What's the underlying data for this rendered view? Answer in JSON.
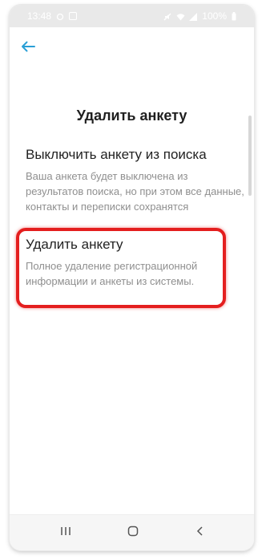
{
  "statusbar": {
    "time": "13:48",
    "battery": "100%"
  },
  "header": {
    "title": "Удалить анкету"
  },
  "options": [
    {
      "title": "Выключить анкету из поиска",
      "description": "Ваша анкета будет выключена из результатов поиска, но при этом все данные, контакты и переписки сохранятся"
    },
    {
      "title": "Удалить анкету",
      "description": "Полное удаление регистрационной информации и анкеты из системы."
    }
  ],
  "colors": {
    "accent": "#2a9fd6",
    "highlight": "#e41e1e",
    "text": "#222222",
    "subtext": "#8f8f8f"
  },
  "icons": {
    "back": "arrow-left-icon",
    "recents": "recents-icon",
    "home": "home-icon",
    "nav_back": "chevron-left-icon"
  }
}
